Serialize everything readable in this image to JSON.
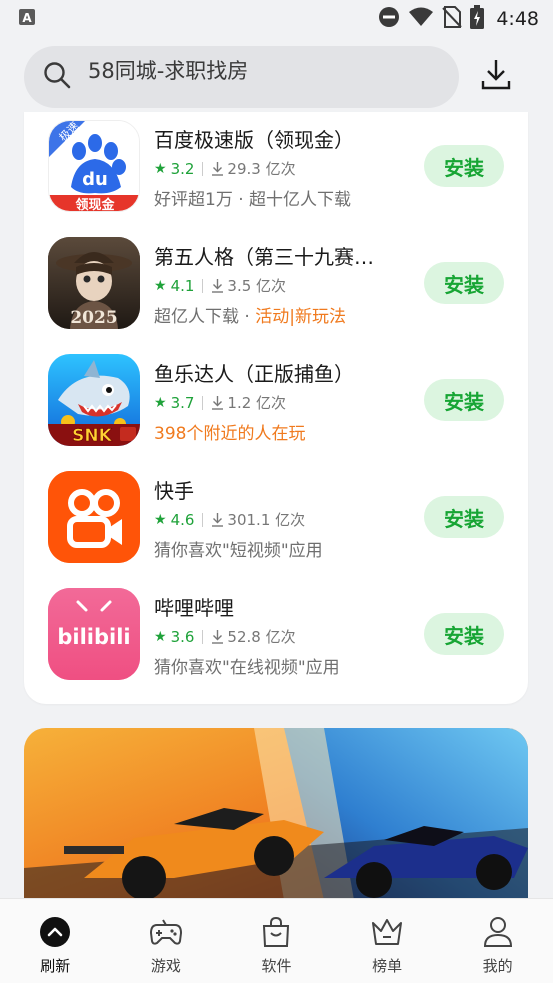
{
  "status_bar": {
    "time": "4:48",
    "left_icon": "a-notification-icon",
    "icons": [
      "dnd-icon",
      "wifi-icon",
      "no-sim-icon",
      "battery-charging-icon"
    ]
  },
  "search": {
    "placeholder": "58同城-求职找房"
  },
  "apps": [
    {
      "name": "百度极速版（领现金）",
      "rating": "3.2",
      "downloads": "29.3 亿次",
      "desc_plain": "好评超1万 · 超十亿人下载",
      "desc_highlight": "",
      "install": "安装",
      "icon": "baidu-icon",
      "icon_text_top": "极速",
      "icon_text_mid": "du",
      "icon_text_bottom": "领现金"
    },
    {
      "name": "第五人格（第三十九赛…",
      "rating": "4.1",
      "downloads": "3.5 亿次",
      "desc_plain": "超亿人下载 · ",
      "desc_highlight": "活动|新玩法",
      "install": "安装",
      "icon": "identity-v-icon",
      "icon_text_bottom": "2025"
    },
    {
      "name": "鱼乐达人（正版捕鱼）",
      "rating": "3.7",
      "downloads": "1.2 亿次",
      "desc_plain": "",
      "desc_highlight": "398个附近的人在玩",
      "install": "安装",
      "icon": "fish-game-icon",
      "icon_text_bottom": "SNK"
    },
    {
      "name": "快手",
      "rating": "4.6",
      "downloads": "301.1 亿次",
      "desc_plain": "猜你喜欢\"短视频\"应用",
      "desc_highlight": "",
      "install": "安装",
      "icon": "kuaishou-icon"
    },
    {
      "name": "哔哩哔哩",
      "rating": "3.6",
      "downloads": "52.8 亿次",
      "desc_plain": "猜你喜欢\"在线视频\"应用",
      "desc_highlight": "",
      "install": "安装",
      "icon": "bilibili-icon",
      "icon_text": "bilibili"
    }
  ],
  "banner": {
    "image": "f1-racing-banner"
  },
  "nav": [
    {
      "label": "刷新",
      "icon": "refresh-up-icon",
      "active": true
    },
    {
      "label": "游戏",
      "icon": "gamepad-icon",
      "active": false
    },
    {
      "label": "软件",
      "icon": "shopping-bag-icon",
      "active": false
    },
    {
      "label": "榜单",
      "icon": "crown-icon",
      "active": false
    },
    {
      "label": "我的",
      "icon": "person-icon",
      "active": false
    }
  ],
  "colors": {
    "accent_green": "#17a534",
    "install_bg": "#dcf5e0",
    "highlight_orange": "#f07a1e"
  }
}
